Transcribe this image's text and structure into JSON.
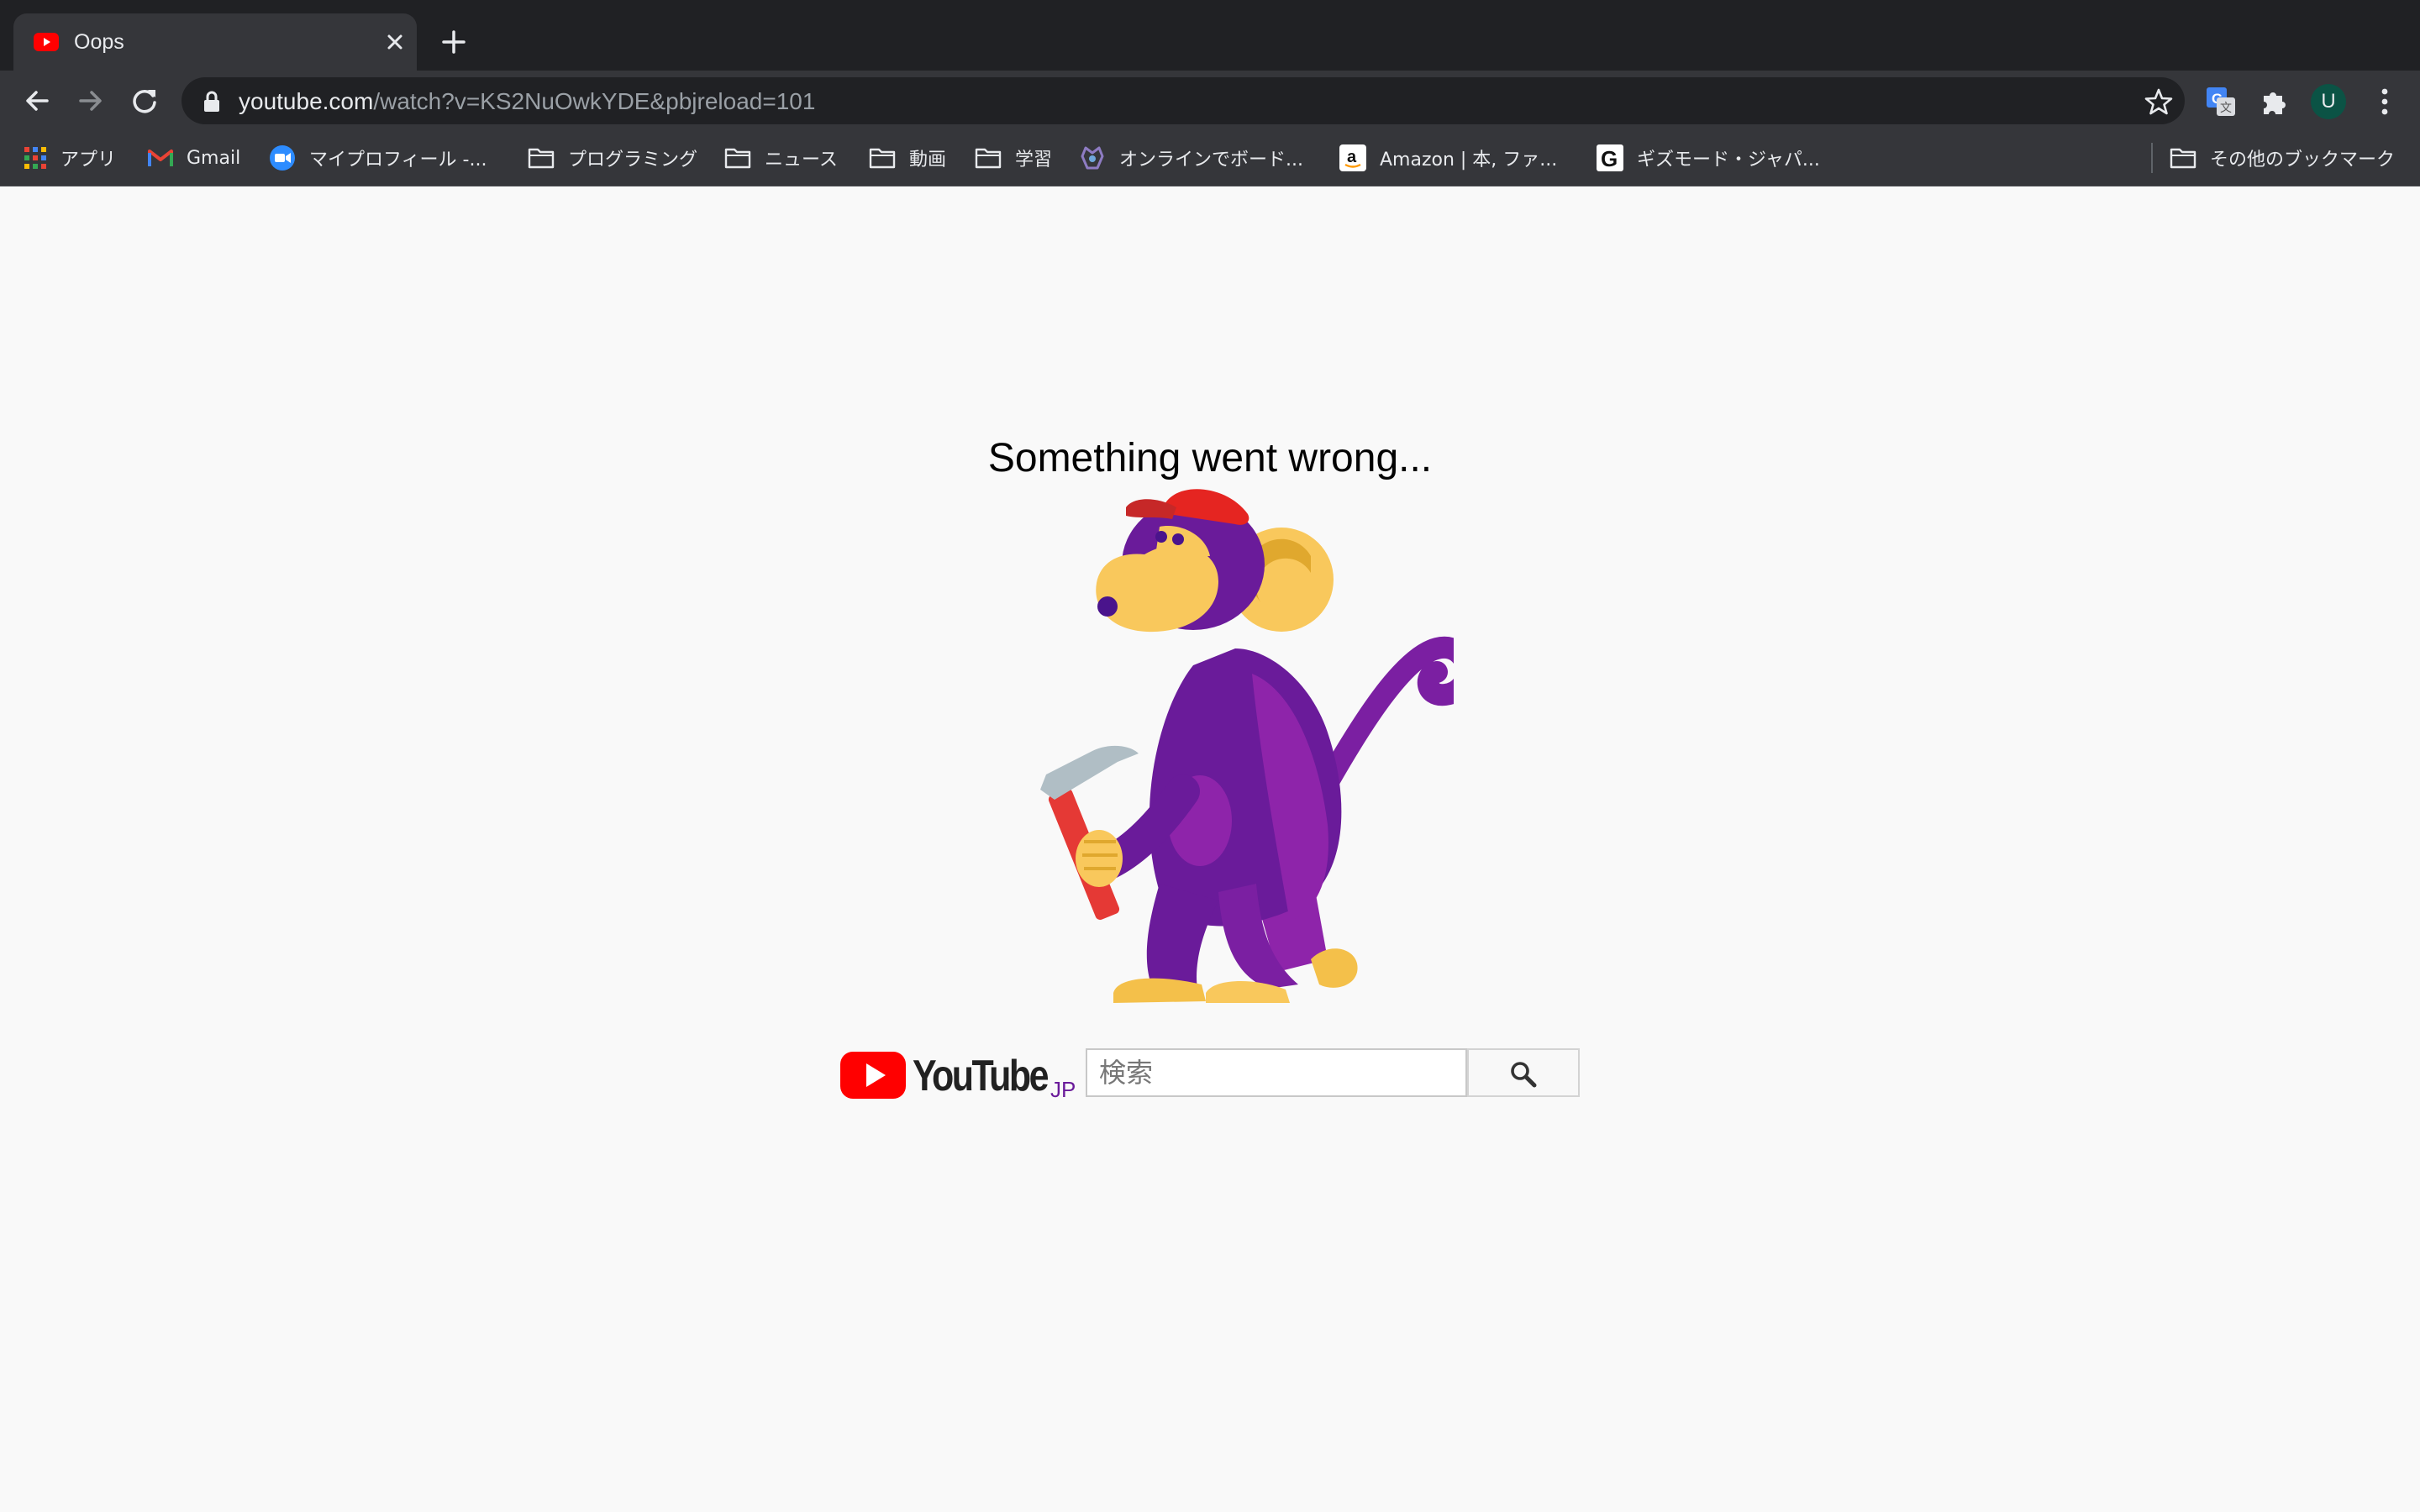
{
  "browser": {
    "tab": {
      "title": "Oops",
      "favicon": "youtube-icon"
    },
    "url": {
      "host": "youtube.com",
      "path": "/watch?v=KS2NuOwkYDE&pbjreload=101"
    },
    "profile_initial": "U",
    "bookmarks": [
      {
        "label": "アプリ",
        "icon": "apps-grid-icon"
      },
      {
        "label": "Gmail",
        "icon": "gmail-icon"
      },
      {
        "label": "マイプロフィール -...",
        "icon": "zoom-icon"
      },
      {
        "label": "プログラミング",
        "icon": "folder-icon"
      },
      {
        "label": "ニュース",
        "icon": "folder-icon"
      },
      {
        "label": "動画",
        "icon": "folder-icon"
      },
      {
        "label": "学習",
        "icon": "folder-icon"
      },
      {
        "label": "オンラインでボード...",
        "icon": "board-game-icon"
      },
      {
        "label": "Amazon | 本, ファ...",
        "icon": "amazon-icon"
      },
      {
        "label": "ギズモード・ジャパ...",
        "icon": "gizmodo-icon"
      }
    ],
    "other_bookmarks": "その他のブックマーク"
  },
  "page": {
    "error_title": "Something went wrong...",
    "logo_region": "JP",
    "search": {
      "placeholder": "検索",
      "value": ""
    }
  },
  "colors": {
    "chrome_dark": "#202124",
    "chrome_toolbar": "#35363a",
    "youtube_red": "#ff0000",
    "monkey_purple": "#6a1b9a",
    "monkey_face": "#f9c85c"
  }
}
